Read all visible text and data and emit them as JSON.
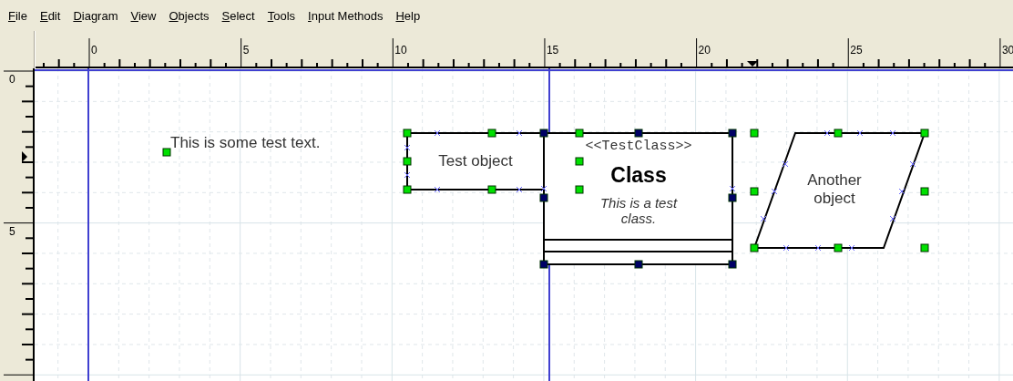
{
  "menu": [
    "File",
    "Edit",
    "Diagram",
    "View",
    "Objects",
    "Select",
    "Tools",
    "Input Methods",
    "Help"
  ],
  "horizontal_ruler": {
    "labels": [
      "0",
      "5",
      "10",
      "15",
      "20",
      "25",
      "30"
    ]
  },
  "vertical_ruler": {
    "labels": [
      "0",
      "5"
    ]
  },
  "objects": [
    {
      "kind": "text",
      "text": "This is some test text.",
      "selected": true
    },
    {
      "kind": "box",
      "text": "Test object",
      "selected": true
    },
    {
      "kind": "uml-class",
      "stereotype": "<<TestClass>>",
      "name": "Class",
      "comment": "This is a test class.",
      "selected": true
    },
    {
      "kind": "parallelogram",
      "text": "Another object",
      "selected": true
    }
  ]
}
